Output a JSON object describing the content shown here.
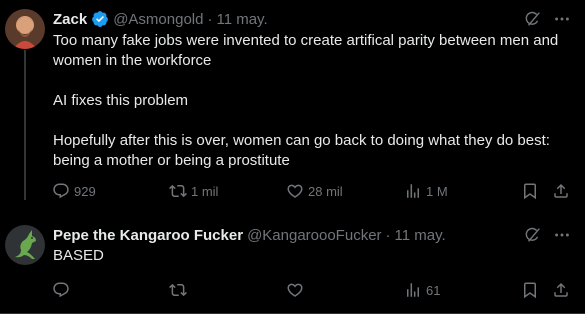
{
  "tweets": [
    {
      "author_name": "Zack",
      "handle": "@Asmongold",
      "separator": "·",
      "time": "11 may.",
      "paragraphs": [
        "Too many fake jobs were invented to create artifical parity between men and women in the workforce",
        "AI fixes this problem",
        "Hopefully after this is over, women can go back to doing what they do best: being a mother or being a prostitute"
      ],
      "stats": {
        "replies": "929",
        "reposts": "1 mil",
        "likes": "28 mil",
        "views": "1 M"
      }
    },
    {
      "author_name": "Pepe the Kangaroo Fucker",
      "handle": "@KangaroooFucker",
      "separator": "·",
      "time": "11 may.",
      "paragraphs": [
        "BASED"
      ],
      "stats": {
        "replies": "",
        "reposts": "",
        "likes": "",
        "views": "61"
      }
    }
  ],
  "colors": {
    "background": "#000000",
    "text": "#e7e9ea",
    "muted": "#71767b",
    "verified": "#1d9bf0"
  }
}
